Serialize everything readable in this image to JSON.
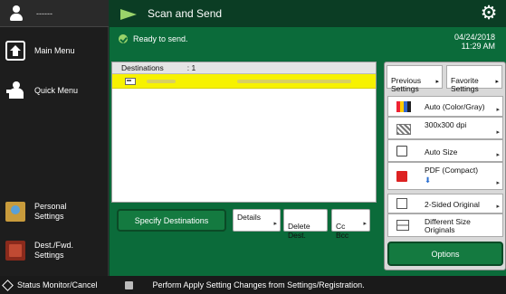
{
  "sidebar": {
    "user_name": "------",
    "items": [
      {
        "label": "Main Menu",
        "icon": "home-icon"
      },
      {
        "label": "Quick Menu",
        "icon": "quick-menu-icon"
      },
      {
        "label": "Personal\nSettings",
        "icon": "personal-settings-icon"
      },
      {
        "label": "Dest./Fwd.\nSettings",
        "icon": "destination-settings-icon"
      }
    ]
  },
  "header": {
    "title": "Scan and Send",
    "icon": "gear-icon"
  },
  "status": {
    "message": "Ready to send.",
    "date": "04/24/2018",
    "time": "11:29 AM"
  },
  "destinations": {
    "header_label": "Destinations",
    "count_label": ":   1"
  },
  "actions": {
    "specify": "Specify Destinations",
    "details": "Details",
    "delete": "Delete\nDest.",
    "cc_bcc": "Cc\nBcc"
  },
  "settings": {
    "previous": "Previous\nSettings",
    "favorite": "Favorite\nSettings",
    "color_mode": "Auto (Color/Gray)",
    "resolution": "300x300 dpi",
    "size": "Auto Size",
    "format": "PDF (Compact)",
    "two_sided": "2-Sided Original",
    "diff_size": "Different Size\nOriginals",
    "options": "Options"
  },
  "footer": {
    "status_monitor": "Status Monitor/Cancel",
    "message": "Perform Apply Setting Changes from Settings/Registration."
  },
  "colors": {
    "accent": "#0b6b3a",
    "header": "#0b3d24",
    "selection": "#f7f200"
  }
}
